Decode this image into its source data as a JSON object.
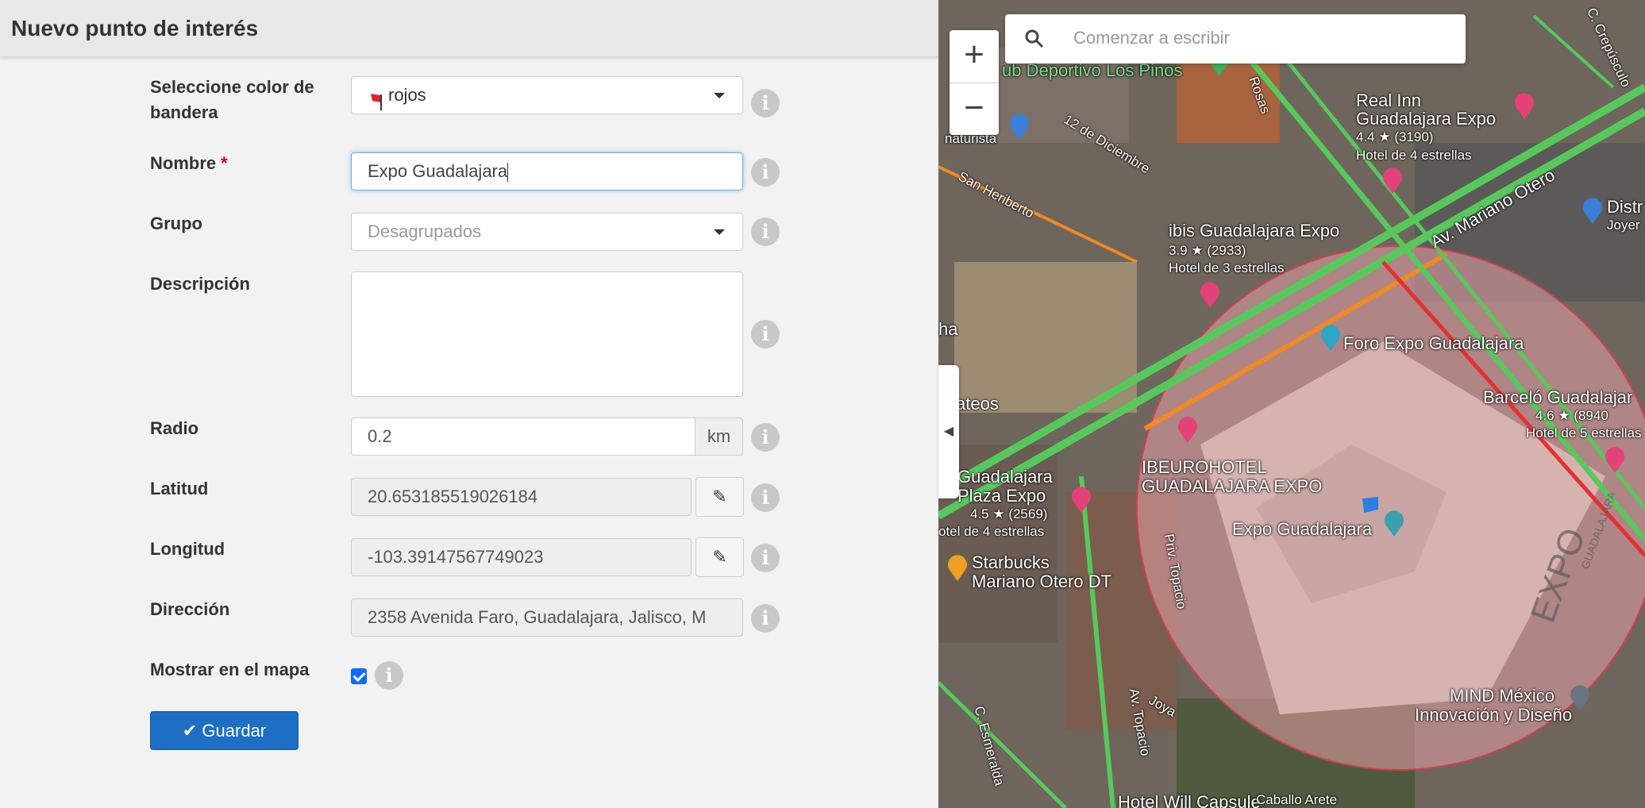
{
  "header": {
    "title": "Nuevo punto de interés"
  },
  "form": {
    "flag_color": {
      "label": "Seleccione color de bandera",
      "value": "rojos"
    },
    "name": {
      "label": "Nombre",
      "required_mark": "*",
      "value": "Expo Guadalajara"
    },
    "group": {
      "label": "Grupo",
      "placeholder": "Desagrupados"
    },
    "description": {
      "label": "Descripción",
      "value": ""
    },
    "radius": {
      "label": "Radio",
      "value": "0.2",
      "unit": "km"
    },
    "latitude": {
      "label": "Latitud",
      "value": "20.653185519026184"
    },
    "longitude": {
      "label": "Longitud",
      "value": "-103.39147567749023"
    },
    "address": {
      "label": "Dirección",
      "value": "2358 Avenida Faro, Guadalajara, Jalisco, M"
    },
    "show_on_map": {
      "label": "Mostrar en el mapa",
      "checked": true
    },
    "save_label": "Guardar"
  },
  "map": {
    "search_placeholder": "Comenzar a escribir",
    "zoom_in": "+",
    "zoom_out": "−",
    "collapse_glyph": "◀",
    "labels": {
      "club": "ub Deportivo Los Pinos",
      "naturista": "naturista",
      "dic12": "12 de Diciembre",
      "heriberto": "San Heriberto",
      "rosas": "Rosas",
      "crepusculo": "C. Crepúsculo",
      "realinn": "Real Inn",
      "realinn2": "Guadalajara Expo",
      "realinn_rating": "4.4 ★ (3190)",
      "realinn_type": "Hotel de 4 estrellas",
      "ibis": "ibis Guadalajara Expo",
      "ibis_rating": "3.9 ★ (2933)",
      "ibis_type": "Hotel de 3 estrellas",
      "mariano": "Av. Mariano Otero",
      "distr": "Distr",
      "joyer": "Joyer",
      "foro": "Foro Expo Guadalajara",
      "barcelo": "Barceló Guadalajar",
      "barcelo_rating": "4.6 ★ (8940",
      "barcelo_type": "Hotel de 5 estrellas",
      "ateos": "ateos",
      "ha": "ha",
      "beuro1": "IBEUROHOTEL",
      "beuro2": "GUADALAJARA EXPO",
      "plaza1": "Guadalajara",
      "plaza2": "Plaza Expo",
      "plaza_rating": "4.5 ★ (2569)",
      "plaza_type": "otel de 4 estrellas",
      "expo": "Expo Guadalajara",
      "starbucks1": "Starbucks",
      "starbucks2": "Mariano Otero DT",
      "priv": "Priv. Topacio",
      "avtopacio": "Av. Topacio",
      "joya": "Joya",
      "esmeralda": "C. Esmeralda",
      "mind1": "MIND México",
      "mind2": "Innovación y Diseño",
      "capsule": "Hotel Will Capsule",
      "caballo": "Caballo Arete",
      "expo_roof": "EXPO",
      "expo_roof2": "GUADALAJARA"
    }
  },
  "colors": {
    "primary": "#1c6fc4",
    "required": "#dd0000",
    "flag": "#e0242c",
    "geofence": "#e8a0a8"
  }
}
